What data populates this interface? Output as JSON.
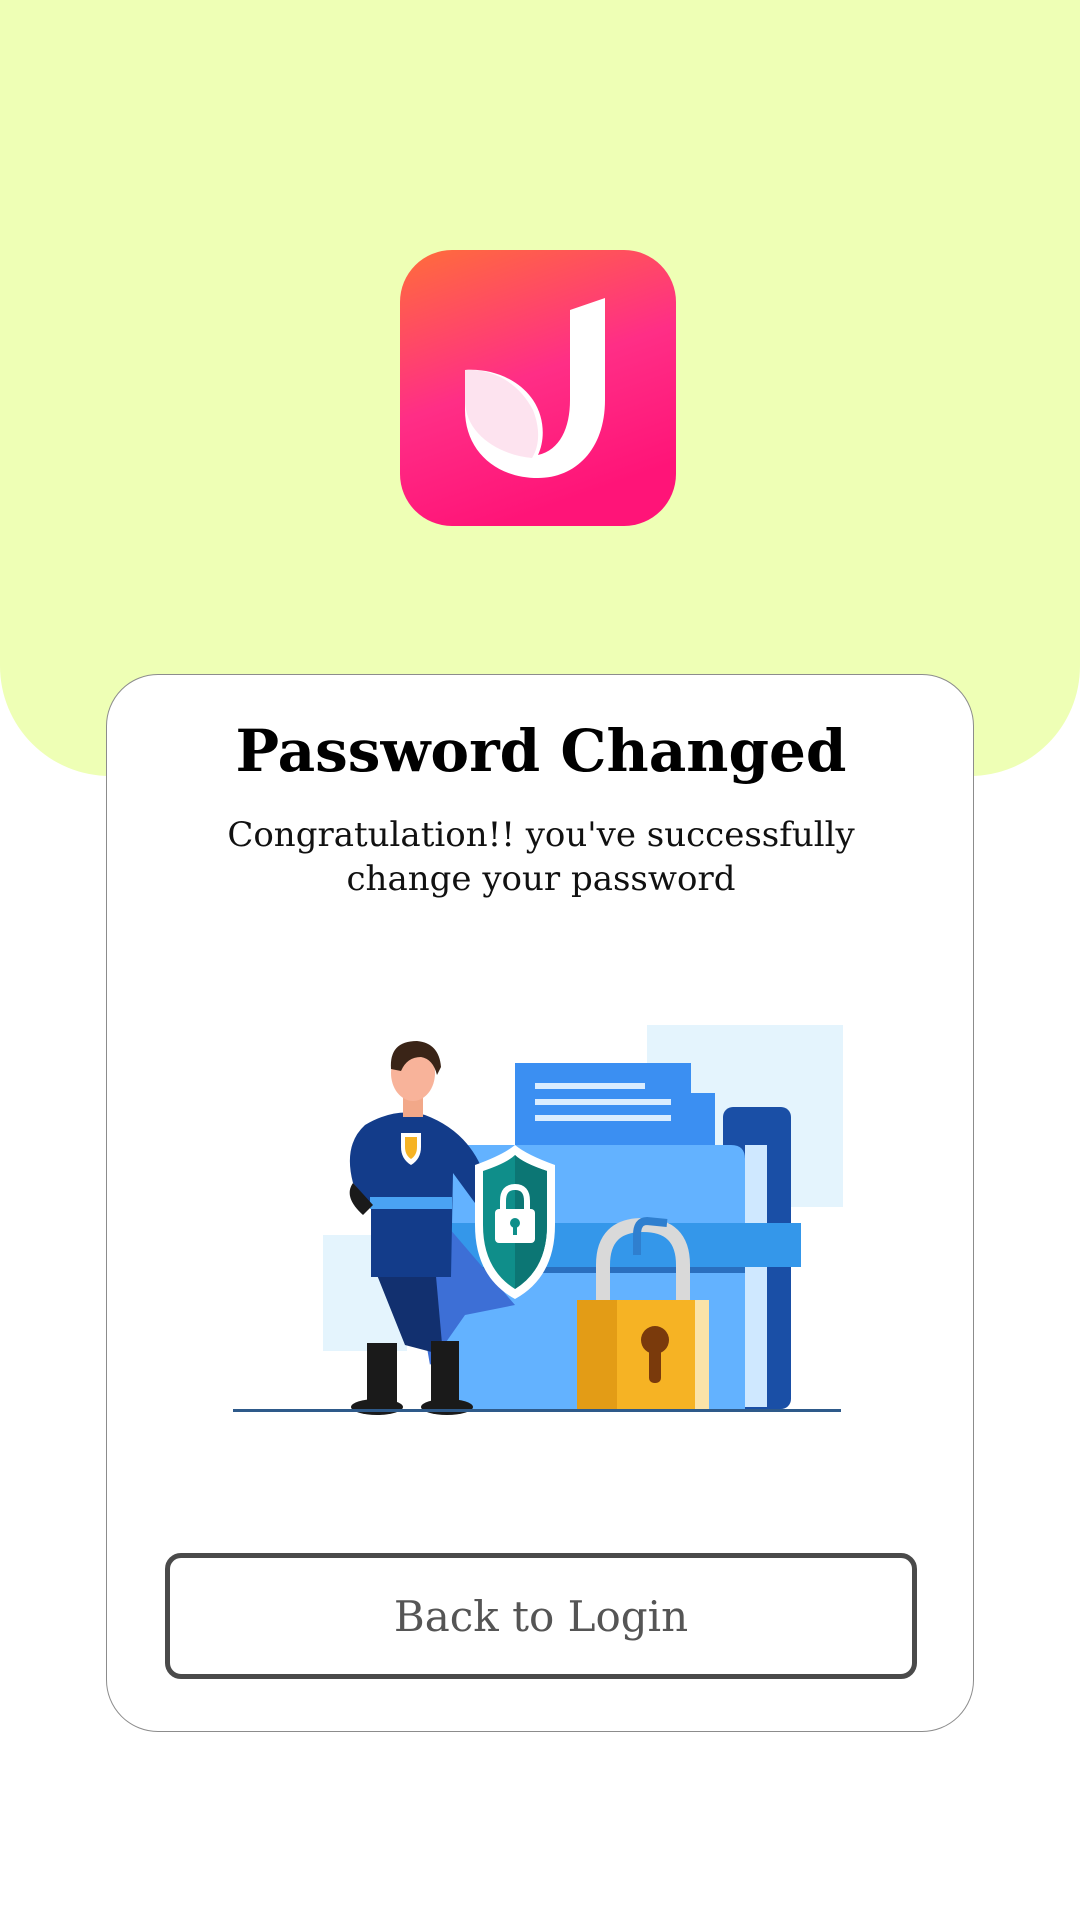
{
  "screen": {
    "title": "Password Changed",
    "message": "Congratulation!! you've successfully change your password",
    "button_label": "Back to Login"
  },
  "icons": {
    "logo": "app-logo-icon",
    "illustration": "superhero-security-illustration"
  },
  "colors": {
    "top_band": "#eeffb5",
    "logo_gradient_top": "#ff6a3d",
    "logo_gradient_bottom": "#ff1f8f",
    "button_border": "#4a4a4a",
    "card_border": "#8c8c8c"
  }
}
